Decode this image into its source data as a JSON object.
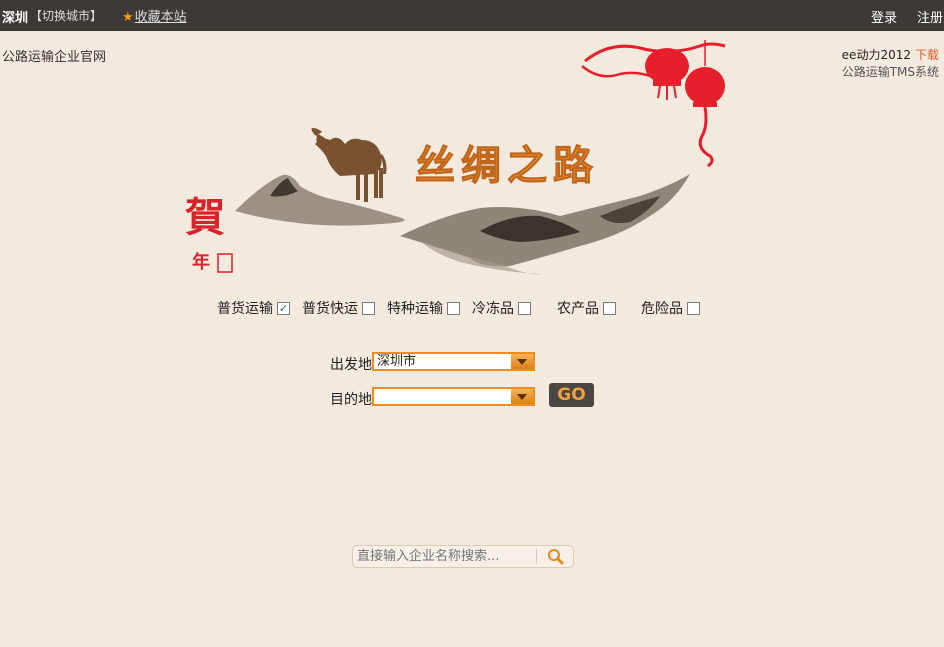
{
  "topbar": {
    "city": "深圳",
    "switch_city": "【切换城市】",
    "favorite": "收藏本站",
    "login": "登录",
    "register": "注册"
  },
  "site_name": "公路运输企业官网",
  "promo": {
    "product": "ee动力2012",
    "download": "下载",
    "tagline": "公路运输TMS系统"
  },
  "banner": {
    "title": "丝绸之路",
    "seal_char": "賀",
    "seal_char2": "年"
  },
  "cargo_types": [
    {
      "label": "普货运输",
      "checked": true
    },
    {
      "label": "普货快运",
      "checked": false
    },
    {
      "label": "特种运输",
      "checked": false
    },
    {
      "label": "冷冻品",
      "checked": false
    },
    {
      "label": "农产品",
      "checked": false
    },
    {
      "label": "危险品",
      "checked": false
    }
  ],
  "route": {
    "origin_label": "出发地",
    "origin_value": "深圳市",
    "destination_label": "目的地",
    "destination_value": "",
    "go_label": "GO"
  },
  "search": {
    "placeholder": "直接输入企业名称搜索..."
  },
  "colors": {
    "accent": "#ef8c1e",
    "topbar": "#3d3a36",
    "background": "#f3eadf",
    "red": "#e5202a"
  }
}
